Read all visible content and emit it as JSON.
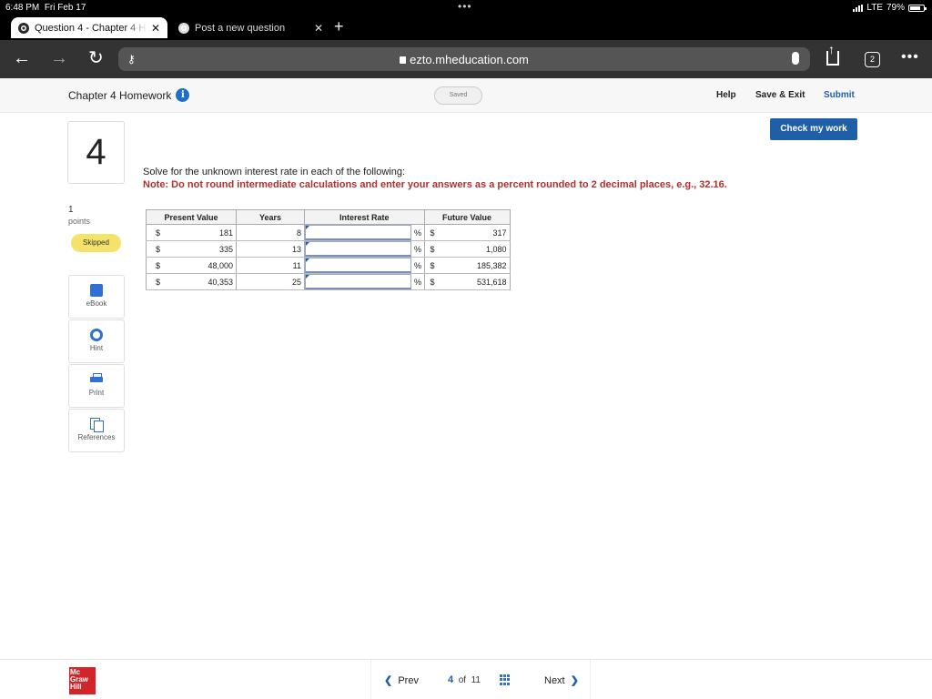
{
  "status_bar": {
    "time": "6:48 PM",
    "date": "Fri Feb 17",
    "network": "LTE",
    "battery": "79%",
    "battery_level": 0.79
  },
  "tabs": [
    {
      "label": "Question 4 - Chapter 4 H",
      "close": "✕"
    },
    {
      "label": "Post a new question",
      "close": "✕"
    }
  ],
  "new_tab": "+",
  "toolbar": {
    "back_icon": "arrow-left-icon",
    "forward_icon": "arrow-right-icon",
    "reload_icon": "reload-icon",
    "key_icon": "key-icon",
    "url": "ezto.mheducation.com",
    "tab_count": "2",
    "more_icon": "•••"
  },
  "header": {
    "title": "Chapter 4 Homework",
    "info_icon": "i",
    "saved": "Saved",
    "help": "Help",
    "save_exit": "Save & Exit",
    "submit": "Submit",
    "check": "Check my work"
  },
  "question": {
    "number": "4",
    "points_value": "1",
    "points_label": "points",
    "status": "Skipped",
    "prompt": "Solve for the unknown interest rate in each of the following:",
    "note": "Note: Do not round intermediate calculations and enter your answers as a percent rounded to 2 decimal places, e.g., 32.16."
  },
  "tools": [
    {
      "label": "eBook",
      "icon": "book-icon"
    },
    {
      "label": "Hint",
      "icon": "lifebuoy-icon"
    },
    {
      "label": "Print",
      "icon": "printer-icon"
    },
    {
      "label": "References",
      "icon": "copy-icon"
    }
  ],
  "table": {
    "headers": [
      "Present Value",
      "Years",
      "Interest Rate",
      "Future Value"
    ],
    "currency": "$",
    "percent": "%",
    "rows": [
      {
        "pv": "181",
        "years": "8",
        "rate": "",
        "fv": "317"
      },
      {
        "pv": "335",
        "years": "13",
        "rate": "",
        "fv": "1,080"
      },
      {
        "pv": "48,000",
        "years": "11",
        "rate": "",
        "fv": "185,382"
      },
      {
        "pv": "40,353",
        "years": "25",
        "rate": "",
        "fv": "531,618"
      }
    ]
  },
  "footer": {
    "logo": [
      "Mc",
      "Graw",
      "Hill"
    ],
    "prev": "Prev",
    "current": "4",
    "of": "of",
    "total": "11",
    "next": "Next"
  },
  "colors": {
    "accent": "#1f5fa8",
    "note_red": "#b03030",
    "skipped_badge": "#f4e26a",
    "brand_red": "#d4242a"
  }
}
